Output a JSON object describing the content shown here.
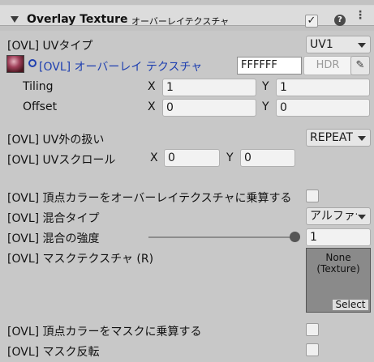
{
  "header": {
    "title": "Overlay Texture",
    "subtitle": "オーバーレイテクスチャ",
    "enabled_mark": "✓",
    "help_glyph": "?",
    "menu_glyph": "⋮"
  },
  "uv_type": {
    "label": "[OVL] UVタイプ",
    "value": "UV1"
  },
  "texture": {
    "label": "[OVL] オーバーレイ テクスチャ",
    "color_hex": "FFFFFF",
    "hdr_label": "HDR",
    "picker_glyph": "✎",
    "tiling": {
      "label": "Tiling",
      "x_label": "X",
      "x": "1",
      "y_label": "Y",
      "y": "1"
    },
    "offset": {
      "label": "Offset",
      "x_label": "X",
      "x": "0",
      "y_label": "Y",
      "y": "0"
    }
  },
  "uv_outside": {
    "label": "[OVL] UV外の扱い",
    "value": "REPEAT"
  },
  "uv_scroll": {
    "label": "[OVL] UVスクロール",
    "x_label": "X",
    "x": "0",
    "y_label": "Y",
    "y": "0"
  },
  "vertex_color_multiply": {
    "label": "[OVL] 頂点カラーをオーバーレイテクスチャに乗算する",
    "checked": false
  },
  "blend_type": {
    "label": "[OVL] 混合タイプ",
    "value": "アルファ合成"
  },
  "blend_power": {
    "label": "[OVL] 混合の強度",
    "value": "1",
    "fraction": 1.0
  },
  "mask_texture": {
    "label": "[OVL] マスクテクスチャ (R)",
    "slot_text": "None\n(Texture)",
    "select_label": "Select"
  },
  "vertex_color_mask": {
    "label": "[OVL] 頂点カラーをマスクに乗算する",
    "checked": false
  },
  "mask_invert": {
    "label": "[OVL] マスク反転",
    "checked": false
  }
}
